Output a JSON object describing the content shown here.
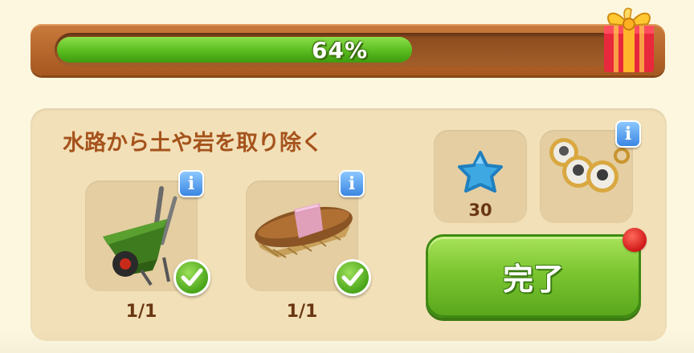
{
  "progress": {
    "label": "64%",
    "value": 0.64
  },
  "task": {
    "title": "水路から土や岩を取り除く",
    "items": [
      {
        "name": "wheelbarrow",
        "count": "1/1",
        "done": true,
        "info": "i"
      },
      {
        "name": "brush",
        "count": "1/1",
        "done": true,
        "info": "i"
      }
    ]
  },
  "rewards": {
    "star": {
      "icon": "blue-star-icon",
      "value": "30"
    },
    "locket": {
      "icon": "locket-icon",
      "info": "i"
    }
  },
  "complete_button": {
    "label": "完了"
  },
  "colors": {
    "title": "#a6531c",
    "progress_fill": "#55b81c",
    "button": "#7cc631",
    "info": "#3b86e2",
    "notification": "#d01818"
  }
}
